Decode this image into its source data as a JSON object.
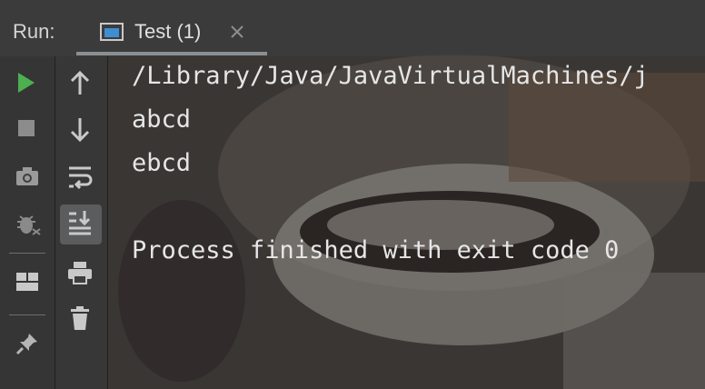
{
  "header": {
    "run_label": "Run:",
    "tab": {
      "title": "Test (1)",
      "icon": "console-window-icon",
      "close_icon": "close-icon"
    }
  },
  "left_toolbar": {
    "items": [
      {
        "name": "rerun-icon",
        "color": "#4caf50"
      },
      {
        "name": "stop-icon"
      },
      {
        "name": "camera-icon"
      },
      {
        "name": "debug-bug-icon"
      },
      {
        "name": "layout-icon"
      },
      {
        "name": "pin-icon"
      }
    ]
  },
  "right_toolbar": {
    "items": [
      {
        "name": "arrow-up-icon"
      },
      {
        "name": "arrow-down-icon"
      },
      {
        "name": "soft-wrap-icon"
      },
      {
        "name": "scroll-to-end-icon",
        "selected": true
      },
      {
        "name": "print-icon"
      },
      {
        "name": "trash-icon"
      }
    ]
  },
  "console": {
    "lines": [
      "/Library/Java/JavaVirtualMachines/j",
      "abcd",
      "ebcd",
      "",
      "Process finished with exit code 0"
    ]
  },
  "colors": {
    "run_icon": "#4caf50",
    "console_text": "#e6e6e6"
  }
}
